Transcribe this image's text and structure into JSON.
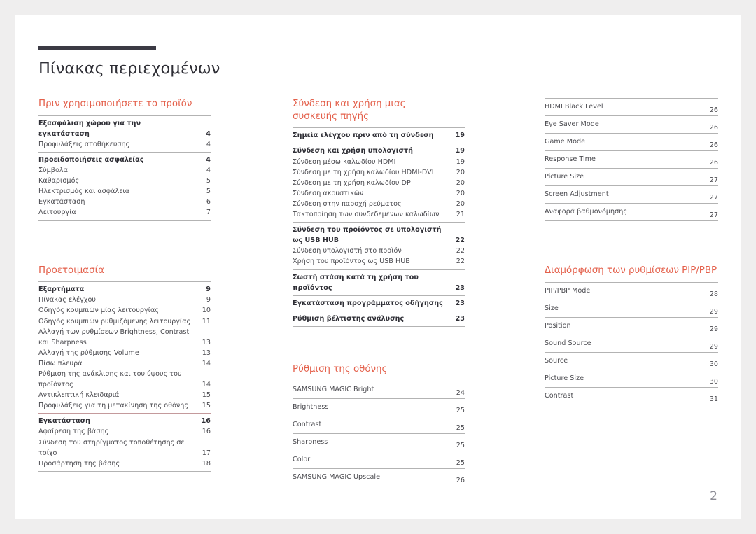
{
  "document": {
    "title": "Πίνακας περιεχομένων",
    "page_number": "2",
    "accent_color": "#e4604b",
    "rule_color": "#b3b3b3",
    "title_rule_color": "#3b3a44",
    "page_number_color": "#8d8d96"
  },
  "columns": [
    {
      "id": "column-1",
      "sections": [
        {
          "heading": "Πριν χρησιμοποιήσετε το προϊόν",
          "groups": [
            {
              "rule": "gray",
              "entries": [
                {
                  "label": "Εξασφάλιση χώρου για την εγκατάσταση",
                  "page": "4",
                  "level": 1
                },
                {
                  "label": "Προφυλάξεις αποθήκευσης",
                  "page": "4",
                  "level": 2
                }
              ]
            },
            {
              "rule": "gray",
              "entries": [
                {
                  "label": "Προειδοποιήσεις ασφαλείας",
                  "page": "4",
                  "level": 1
                },
                {
                  "label": "Σύμβολα",
                  "page": "4",
                  "level": 2
                },
                {
                  "label": "Καθαρισμός",
                  "page": "5",
                  "level": 2
                },
                {
                  "label": "Ηλεκτρισμός και ασφάλεια",
                  "page": "5",
                  "level": 2
                },
                {
                  "label": "Εγκατάσταση",
                  "page": "6",
                  "level": 2
                },
                {
                  "label": "Λειτουργία",
                  "page": "7",
                  "level": 2
                }
              ]
            }
          ]
        },
        {
          "heading": "Προετοιμασία",
          "groups": [
            {
              "rule": "gray",
              "entries": [
                {
                  "label": "Εξαρτήματα",
                  "page": "9",
                  "level": 1
                },
                {
                  "label": "Πίνακας ελέγχου",
                  "page": "9",
                  "level": 2
                },
                {
                  "label": "Οδηγός κουμπιών μίας λειτουργίας",
                  "page": "10",
                  "level": 2
                },
                {
                  "label": "Οδηγός κουμπιών ρυθμιζόμενης λειτουργίας",
                  "page": "11",
                  "level": 2
                },
                {
                  "label": "Αλλαγή των ρυθμίσεων Brightness, Contrast και Sharpness",
                  "page": "13",
                  "level": 2
                },
                {
                  "label": "Αλλαγή της ρύθμισης Volume",
                  "page": "13",
                  "level": 2
                },
                {
                  "label": "Πίσω πλευρά",
                  "page": "14",
                  "level": 2
                },
                {
                  "label": "Ρύθμιση της ανάκλισης και του ύψους του προϊόντος",
                  "page": "14",
                  "level": 2
                },
                {
                  "label": "Αντικλεπτική κλειδαριά",
                  "page": "15",
                  "level": 2
                },
                {
                  "label": "Προφυλάξεις για τη μετακίνηση της οθόνης",
                  "page": "15",
                  "level": 2
                }
              ]
            },
            {
              "rule": "rose",
              "entries": [
                {
                  "label": "Εγκατάσταση",
                  "page": "16",
                  "level": 1
                },
                {
                  "label": "Αφαίρεση της βάσης",
                  "page": "16",
                  "level": 2
                },
                {
                  "label": "Σύνδεση του στηρίγματος τοποθέτησης σε τοίχο",
                  "page": "17",
                  "level": 2
                },
                {
                  "label": "Προσάρτηση της βάσης",
                  "page": "18",
                  "level": 2
                }
              ]
            }
          ]
        }
      ]
    },
    {
      "id": "column-2",
      "sections": [
        {
          "heading": "Σύνδεση και χρήση μιας\nσυσκευής πηγής",
          "groups": [
            {
              "rule": "gray",
              "entries": [
                {
                  "label": "Σημεία ελέγχου πριν από τη σύνδεση",
                  "page": "19",
                  "level": 1
                }
              ]
            },
            {
              "rule": "gray",
              "entries": [
                {
                  "label": "Σύνδεση και χρήση υπολογιστή",
                  "page": "19",
                  "level": 1
                },
                {
                  "label": "Σύνδεση μέσω καλωδίου HDMI",
                  "page": "19",
                  "level": 2
                },
                {
                  "label": "Σύνδεση με τη χρήση καλωδίου HDMI-DVI",
                  "page": "20",
                  "level": 2
                },
                {
                  "label": "Σύνδεση με τη χρήση καλωδίου DP",
                  "page": "20",
                  "level": 2
                },
                {
                  "label": "Σύνδεση ακουστικών",
                  "page": "20",
                  "level": 2
                },
                {
                  "label": "Σύνδεση στην παροχή ρεύματος",
                  "page": "20",
                  "level": 2
                },
                {
                  "label": "Τακτοποίηση των συνδεδεμένων καλωδίων",
                  "page": "21",
                  "level": 2
                }
              ]
            },
            {
              "rule": "gray",
              "entries": [
                {
                  "label": "Σύνδεση του προϊόντος σε υπολογιστή ως USB HUB",
                  "page": "22",
                  "level": 1
                },
                {
                  "label": "Σύνδεση υπολογιστή στο προϊόν",
                  "page": "22",
                  "level": 2
                },
                {
                  "label": "Χρήση του προϊόντος ως USB HUB",
                  "page": "22",
                  "level": 2
                }
              ]
            },
            {
              "rule": "gray",
              "entries": [
                {
                  "label": "Σωστή στάση κατά τη χρήση του προϊόντος",
                  "page": "23",
                  "level": 1
                }
              ]
            },
            {
              "rule": "gray",
              "entries": [
                {
                  "label": "Εγκατάσταση προγράμματος οδήγησης",
                  "page": "23",
                  "level": 1
                }
              ]
            },
            {
              "rule": "gray",
              "entries": [
                {
                  "label": "Ρύθμιση βέλτιστης ανάλυσης",
                  "page": "23",
                  "level": 1
                }
              ]
            }
          ]
        },
        {
          "heading": "Ρύθμιση της οθόνης",
          "ruled": true,
          "entries": [
            {
              "label": "SAMSUNG MAGIC Bright",
              "page": "24"
            },
            {
              "label": "Brightness",
              "page": "25"
            },
            {
              "label": "Contrast",
              "page": "25"
            },
            {
              "label": "Sharpness",
              "page": "25"
            },
            {
              "label": "Color",
              "page": "25"
            },
            {
              "label": "SAMSUNG MAGIC Upscale",
              "page": "26"
            }
          ]
        }
      ]
    },
    {
      "id": "column-3",
      "sections": [
        {
          "heading": "",
          "ruled": true,
          "entries": [
            {
              "label": "HDMI Black Level",
              "page": "26"
            },
            {
              "label": "Eye Saver Mode",
              "page": "26"
            },
            {
              "label": "Game Mode",
              "page": "26"
            },
            {
              "label": "Response Time",
              "page": "26"
            },
            {
              "label": "Picture Size",
              "page": "27"
            },
            {
              "label": "Screen Adjustment",
              "page": "27"
            },
            {
              "label": "Αναφορά βαθμονόμησης",
              "page": "27"
            }
          ]
        },
        {
          "heading": "Διαμόρφωση των ρυθμίσεων PIP/PBP",
          "ruled": true,
          "entries": [
            {
              "label": "PIP/PBP Mode",
              "page": "28"
            },
            {
              "label": "Size",
              "page": "29"
            },
            {
              "label": "Position",
              "page": "29"
            },
            {
              "label": "Sound Source",
              "page": "29"
            },
            {
              "label": "Source",
              "page": "30"
            },
            {
              "label": "Picture Size",
              "page": "30"
            },
            {
              "label": "Contrast",
              "page": "31"
            }
          ]
        }
      ]
    }
  ]
}
